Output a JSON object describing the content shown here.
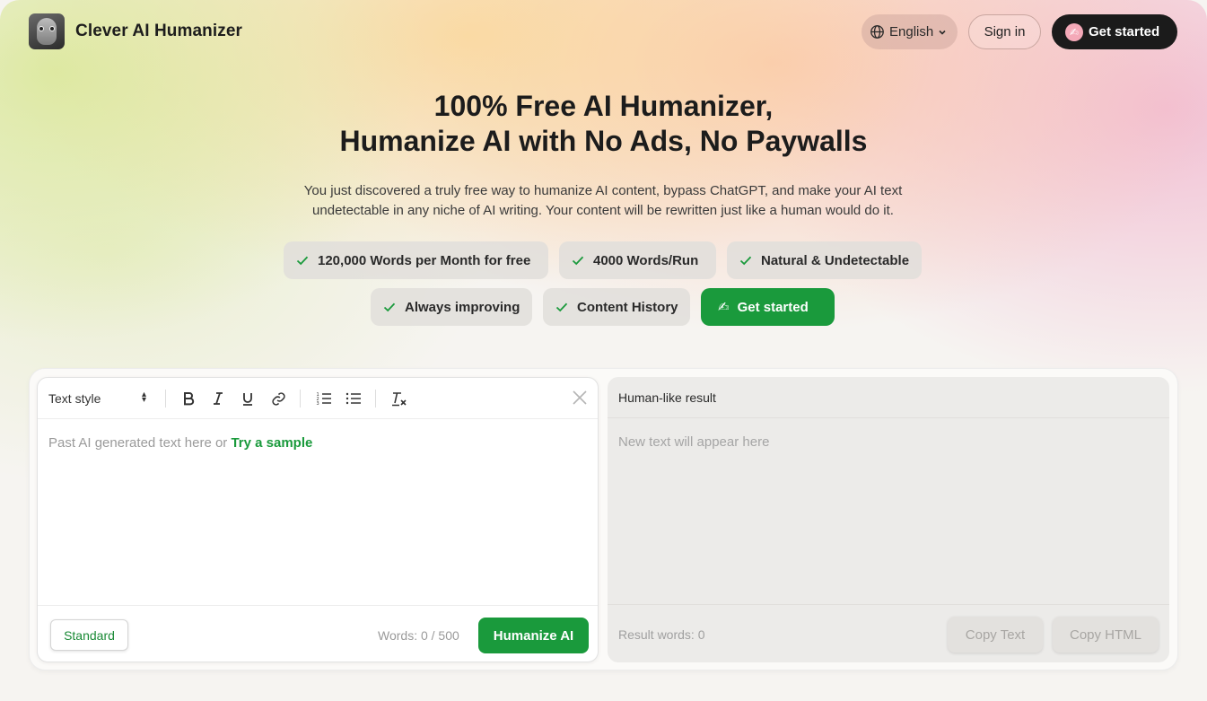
{
  "header": {
    "brand": "Clever AI Humanizer",
    "language": "English",
    "sign_in": "Sign in",
    "get_started": "Get started",
    "cta_emoji": "✍"
  },
  "hero": {
    "title_line1": "100% Free AI Humanizer,",
    "title_line2": "Humanize AI with No Ads, No Paywalls",
    "subtitle_line1": "You just discovered a truly free way to humanize AI content, bypass ChatGPT, and make your AI text",
    "subtitle_line2": "undetectable in any niche of AI writing. Your content will be rewritten just like a human would do it."
  },
  "features": [
    "120,000 Words per Month for free",
    "4000 Words/Run",
    "Natural & Undetectable",
    "Always improving",
    "Content History"
  ],
  "features_cta": "Get started",
  "editor": {
    "text_style": "Text style",
    "placeholder": "Past AI generated text here or ",
    "sample_link": "Try a sample",
    "mode_button": "Standard",
    "word_count": "Words: 0 / 500",
    "humanize_button": "Humanize AI"
  },
  "result": {
    "title": "Human-like result",
    "placeholder": "New text will appear here",
    "result_words": "Result words: 0",
    "copy_text": "Copy Text",
    "copy_html": "Copy HTML"
  },
  "colors": {
    "accent_green": "#1a9a3c",
    "dark_button": "#1b1b1b"
  }
}
